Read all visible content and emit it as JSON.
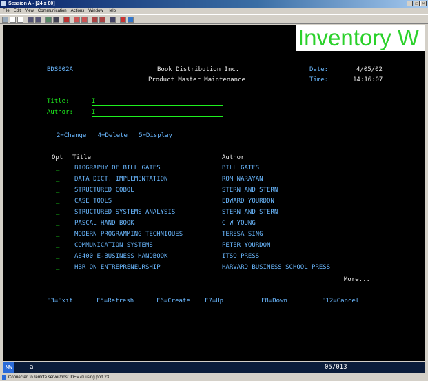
{
  "window": {
    "title": "Session A - [24 x 80]",
    "controls": [
      "_",
      "□",
      "×"
    ]
  },
  "menu": [
    "File",
    "Edit",
    "View",
    "Communication",
    "Actions",
    "Window",
    "Help"
  ],
  "banner": "Inventory W",
  "header": {
    "screen_id": "BDS002A",
    "company": "Book Distribution Inc.",
    "subtitle": "Product Master Maintenance",
    "date_label": "Date:",
    "date_value": "4/05/02",
    "time_label": "Time:",
    "time_value": "14:16:07"
  },
  "search": {
    "title_label": "Title:",
    "title_value": "I",
    "author_label": "Author:",
    "author_value": "I"
  },
  "options_line": "2=Change   4=Delete   5=Display",
  "columns": {
    "opt": "Opt",
    "title": "Title",
    "author": "Author"
  },
  "rows": [
    {
      "title": "BIOGRAPHY OF BILL GATES",
      "author": "BILL GATES"
    },
    {
      "title": "DATA DICT. IMPLEMENTATION",
      "author": "ROM NARAYAN"
    },
    {
      "title": "STRUCTURED COBOL",
      "author": "STERN AND STERN"
    },
    {
      "title": "CASE TOOLS",
      "author": "EDWARD YOURDON"
    },
    {
      "title": "STRUCTURED SYSTEMS ANALYSIS",
      "author": "STERN AND STERN"
    },
    {
      "title": "PASCAL HAND BOOK",
      "author": "C W YOUNG"
    },
    {
      "title": "MODERN PROGRAMMING TECHNIQUES",
      "author": "TERESA SING"
    },
    {
      "title": "COMMUNICATION SYSTEMS",
      "author": "PETER YOURDON"
    },
    {
      "title": "AS400 E-BUSINESS HANDBOOK",
      "author": "ITSO PRESS"
    },
    {
      "title": "HBR ON ENTREPRENEURSHIP",
      "author": "HARVARD BUSINESS SCHOOL PRESS"
    }
  ],
  "opt_placeholder": "_",
  "more": "More...",
  "fkeys": [
    "F3=Exit",
    "F5=Refresh",
    "F6=Create",
    "F7=Up",
    "F8=Down",
    "F12=Cancel"
  ],
  "status": {
    "mode": "MW",
    "indicator": "a",
    "cursor": "05/013"
  },
  "bottom_status": "Connected to remote server/host IDEV70 using port 23",
  "colors": {
    "green": "#1ef01e",
    "white": "#eaeaea",
    "blue": "#6ab8ff",
    "black": "#000000"
  }
}
